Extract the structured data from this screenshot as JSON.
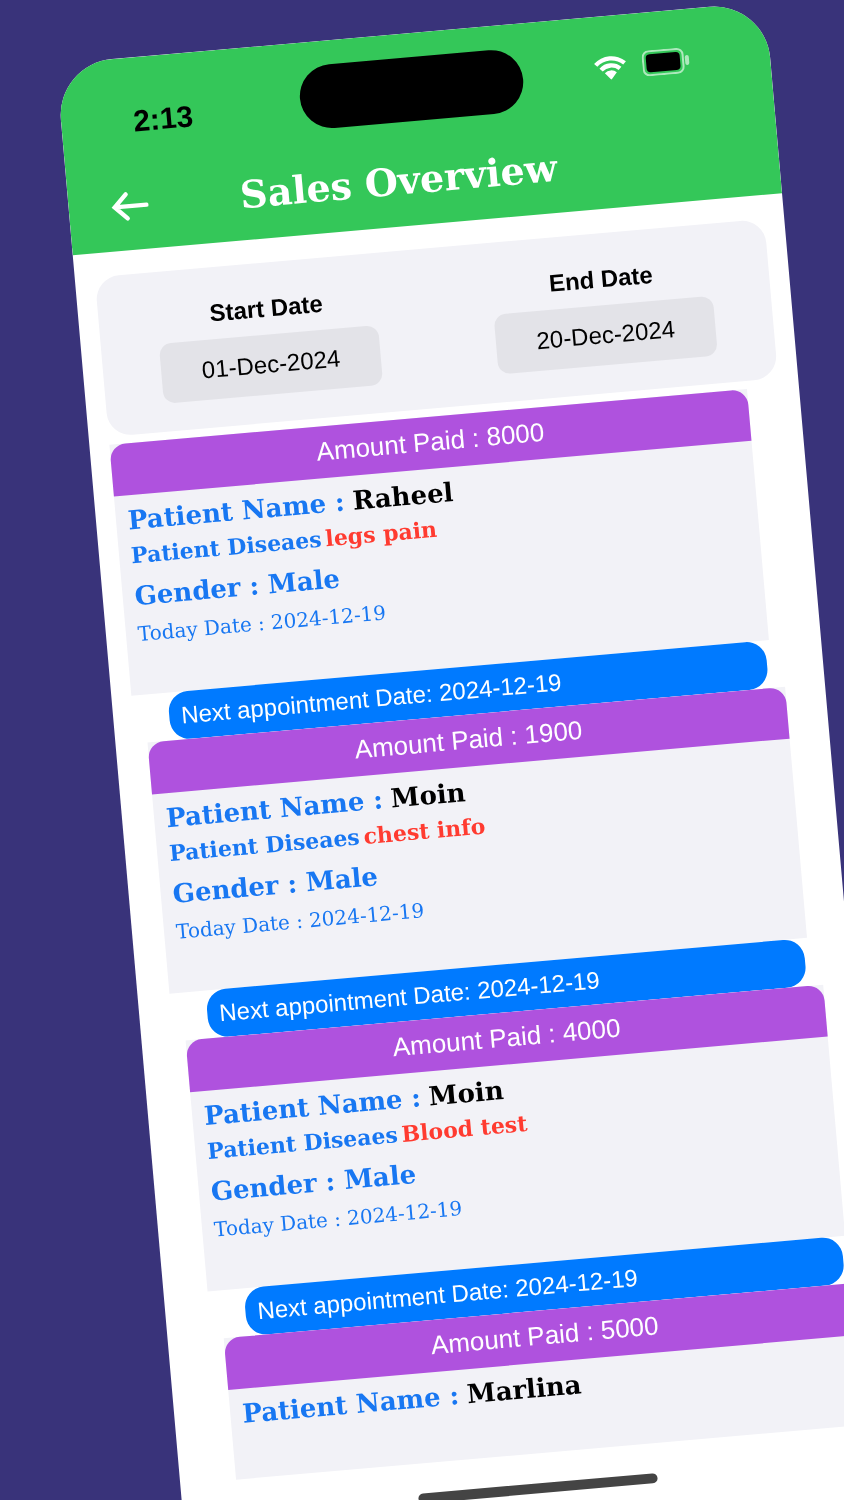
{
  "status_bar": {
    "time": "2:13"
  },
  "header": {
    "title": "Sales Overview"
  },
  "filters": [
    {
      "label": "Start Date",
      "value": "01-Dec-2024"
    },
    {
      "label": "End Date",
      "value": "20-Dec-2024"
    }
  ],
  "records": [
    {
      "amount": "Amount Paid : 8000",
      "name_label": "Patient Name :",
      "name": "Raheel",
      "disease_label": "Patient Diseaes",
      "disease": "legs pain",
      "gender": "Gender : Male",
      "today_date": "Today Date : 2024-12-19",
      "next_appointment": "Next appointment Date: 2024-12-19"
    },
    {
      "amount": "Amount Paid : 1900",
      "name_label": "Patient Name :",
      "name": "Moin",
      "disease_label": "Patient Diseaes",
      "disease": "chest info",
      "gender": "Gender : Male",
      "today_date": "Today Date : 2024-12-19",
      "next_appointment": "Next appointment Date: 2024-12-19"
    },
    {
      "amount": "Amount Paid : 4000",
      "name_label": "Patient Name :",
      "name": "Moin",
      "disease_label": "Patient Diseaes",
      "disease": "Blood test",
      "gender": "Gender : Male",
      "today_date": "Today Date : 2024-12-19",
      "next_appointment": "Next appointment Date: 2024-12-19"
    },
    {
      "amount": "Amount Paid : 5000",
      "name_label": "Patient Name :",
      "name": "Marlina"
    }
  ]
}
